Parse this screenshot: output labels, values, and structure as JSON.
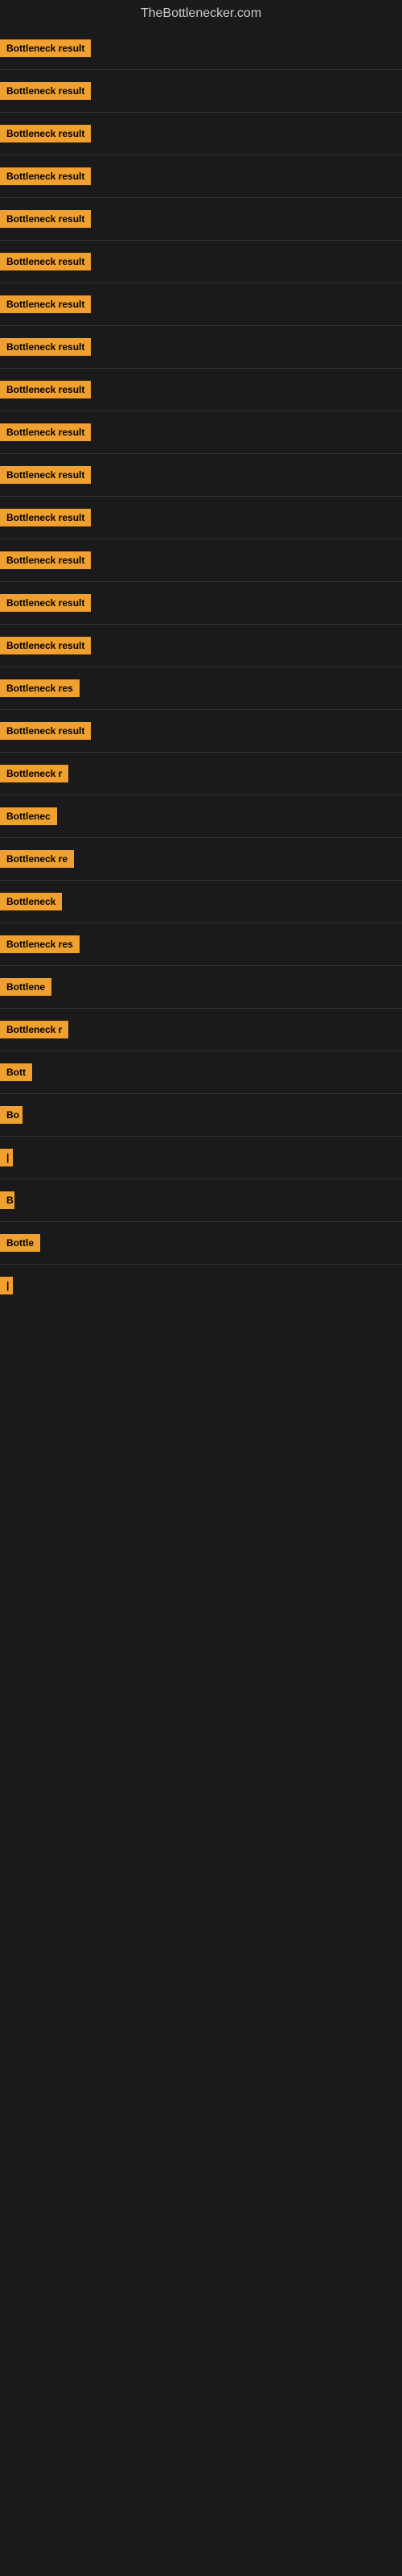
{
  "site_title": "TheBottlenecker.com",
  "items": [
    {
      "label": "Bottleneck result",
      "badge_width": 130
    },
    {
      "label": "Bottleneck result",
      "badge_width": 130
    },
    {
      "label": "Bottleneck result",
      "badge_width": 130
    },
    {
      "label": "Bottleneck result",
      "badge_width": 130
    },
    {
      "label": "Bottleneck result",
      "badge_width": 130
    },
    {
      "label": "Bottleneck result",
      "badge_width": 130
    },
    {
      "label": "Bottleneck result",
      "badge_width": 130
    },
    {
      "label": "Bottleneck result",
      "badge_width": 130
    },
    {
      "label": "Bottleneck result",
      "badge_width": 130
    },
    {
      "label": "Bottleneck result",
      "badge_width": 130
    },
    {
      "label": "Bottleneck result",
      "badge_width": 130
    },
    {
      "label": "Bottleneck result",
      "badge_width": 130
    },
    {
      "label": "Bottleneck result",
      "badge_width": 130
    },
    {
      "label": "Bottleneck result",
      "badge_width": 130
    },
    {
      "label": "Bottleneck result",
      "badge_width": 120
    },
    {
      "label": "Bottleneck res",
      "badge_width": 105
    },
    {
      "label": "Bottleneck result",
      "badge_width": 115
    },
    {
      "label": "Bottleneck r",
      "badge_width": 95
    },
    {
      "label": "Bottlenec",
      "badge_width": 82
    },
    {
      "label": "Bottleneck re",
      "badge_width": 100
    },
    {
      "label": "Bottleneck",
      "badge_width": 80
    },
    {
      "label": "Bottleneck res",
      "badge_width": 105
    },
    {
      "label": "Bottlene",
      "badge_width": 72
    },
    {
      "label": "Bottleneck r",
      "badge_width": 90
    },
    {
      "label": "Bott",
      "badge_width": 40
    },
    {
      "label": "Bo",
      "badge_width": 28
    },
    {
      "label": "|",
      "badge_width": 10
    },
    {
      "label": "B",
      "badge_width": 18
    },
    {
      "label": "Bottle",
      "badge_width": 52
    },
    {
      "label": "|",
      "badge_width": 8
    }
  ]
}
